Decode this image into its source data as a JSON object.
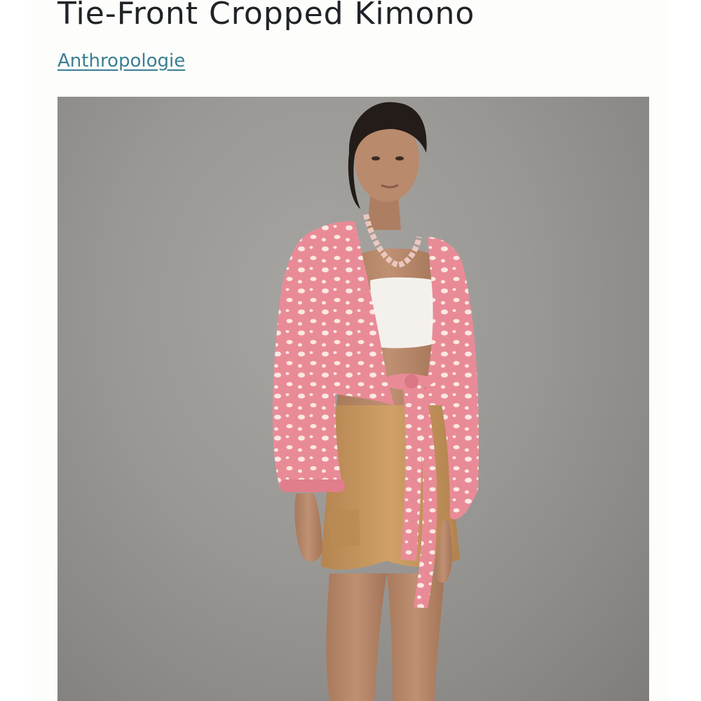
{
  "product": {
    "title": "Tie-Front Cropped Kimono",
    "brand": "Anthropologie"
  },
  "photo": {
    "subject": "product-photo",
    "colors": {
      "background": "#9a9895",
      "kimono": "#e98b97",
      "dots": "#fbe8e3",
      "shorts": "#c99a5f",
      "bralette": "#f4f1ec",
      "skin": "#b98a6c",
      "hair": "#241c18"
    }
  },
  "colors": {
    "title": "#1f2327",
    "link": "#3a7f93"
  }
}
